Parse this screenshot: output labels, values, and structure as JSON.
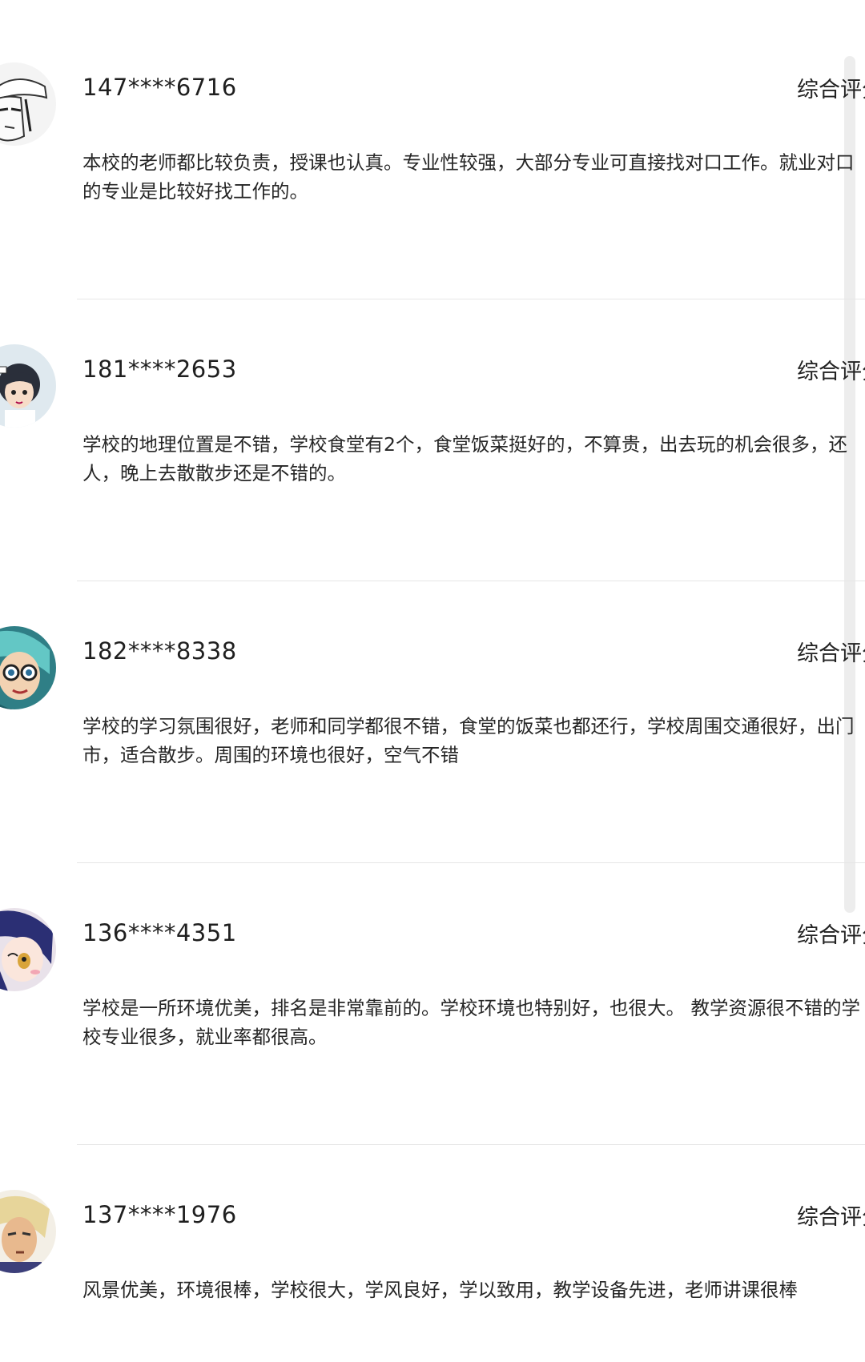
{
  "reviews": [
    {
      "phone": "147****6716",
      "score_label": "综合评分",
      "comment_lines": [
        "本校的老师都比较负责，授课也认真。专业性较强，大部分专业可直接找对口工作。就业对口",
        "的专业是比较好找工作的。"
      ],
      "avatar_icon": "avatar-manga-boy-cap"
    },
    {
      "phone": "181****2653",
      "score_label": "综合评分",
      "comment_lines": [
        "学校的地理位置是不错，学校食堂有2个，食堂饭菜挺好的，不算贵，出去玩的机会很多，还",
        "人，晚上去散散步还是不错的。"
      ],
      "avatar_icon": "avatar-cartoon-boy"
    },
    {
      "phone": "182****8338",
      "score_label": "综合评分",
      "comment_lines": [
        "学校的学习氛围很好，老师和同学都很不错，食堂的饭菜也都还行，学校周围交通很好，出门",
        "市，适合散步。周围的环境也很好，空气不错"
      ],
      "avatar_icon": "avatar-anime-glasses"
    },
    {
      "phone": "136****4351",
      "score_label": "综合评分",
      "comment_lines": [
        "学校是一所环境优美，排名是非常靠前的。学校环境也特别好，也很大。 教学资源很不错的学",
        "校专业很多，就业率都很高。"
      ],
      "avatar_icon": "avatar-anime-girl"
    },
    {
      "phone": "137****1976",
      "score_label": "综合评分",
      "comment_lines": [
        "风景优美，环境很棒，学校很大，学风良好，学以致用，教学设备先进，老师讲课很棒"
      ],
      "avatar_icon": "avatar-blond-warrior"
    }
  ]
}
